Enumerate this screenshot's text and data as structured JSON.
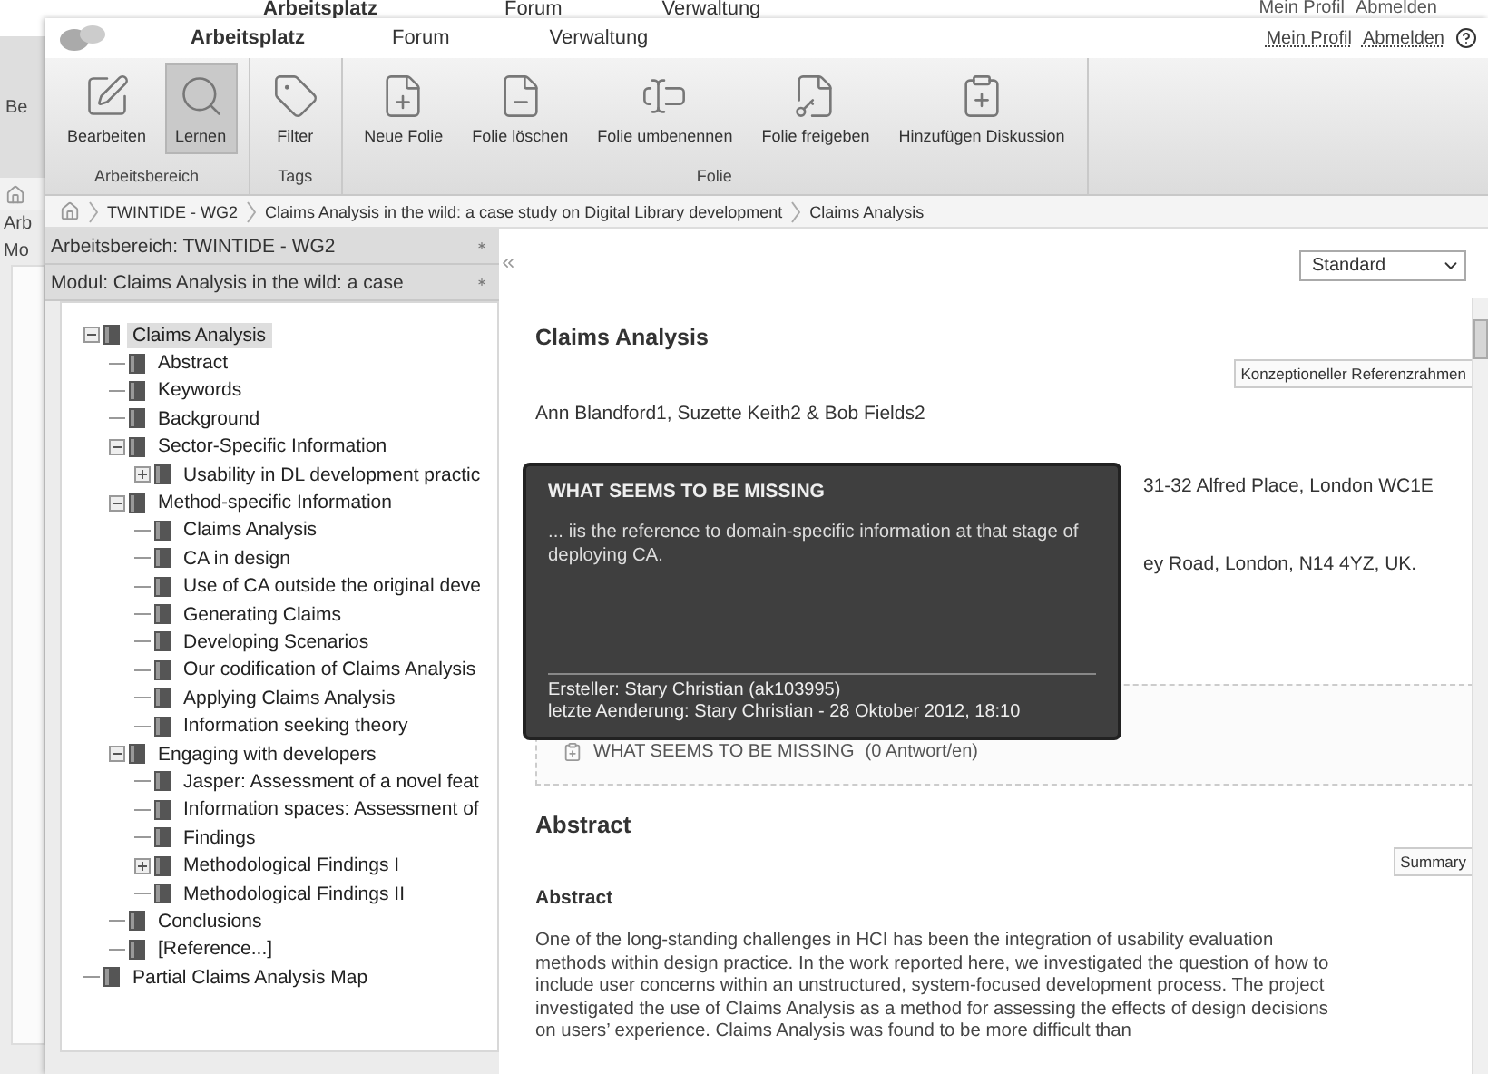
{
  "back_window": {
    "tabs": [
      {
        "label": "Arbeitsplatz",
        "selected": true
      },
      {
        "label": "Forum",
        "selected": false
      },
      {
        "label": "Verwaltung",
        "selected": false
      }
    ],
    "links": [
      "Mein Profil",
      "Abmelden"
    ],
    "side_texts": [
      "Be",
      "Arb",
      "Mo"
    ]
  },
  "header": {
    "tabs": [
      {
        "label": "Arbeitsplatz",
        "selected": true
      },
      {
        "label": "Forum",
        "selected": false
      },
      {
        "label": "Verwaltung",
        "selected": false
      }
    ],
    "links": [
      "Mein Profil",
      "Abmelden"
    ]
  },
  "ribbon": {
    "groups": [
      {
        "label": "Arbeitsbereich",
        "buttons": [
          {
            "label": "Bearbeiten",
            "kind": "edit",
            "selected": false
          },
          {
            "label": "Lernen",
            "kind": "learn",
            "selected": true
          }
        ]
      },
      {
        "label": "Tags",
        "buttons": [
          {
            "label": "Filter",
            "kind": "tag",
            "selected": false
          }
        ]
      },
      {
        "label": "Folie",
        "buttons": [
          {
            "label": "Neue Folie",
            "kind": "new",
            "selected": false
          },
          {
            "label": "Folie löschen",
            "kind": "delete",
            "selected": false
          },
          {
            "label": "Folie umbenennen",
            "kind": "rename",
            "selected": false
          },
          {
            "label": "Folie freigeben",
            "kind": "share",
            "selected": false
          },
          {
            "label": "Hinzufügen Diskussion",
            "kind": "discussion",
            "selected": false
          }
        ]
      }
    ]
  },
  "breadcrumb": [
    "TWINTIDE - WG2",
    "Claims Analysis in the wild: a case study on Digital Library development",
    "Claims Analysis"
  ],
  "sidebar": {
    "workspace": "Arbeitsbereich: TWINTIDE - WG2",
    "module": "Modul: Claims Analysis in the wild: a case",
    "tree": [
      {
        "label": "Claims Analysis",
        "selected": true,
        "expanded": true,
        "children": [
          {
            "label": "Abstract",
            "selected": false
          },
          {
            "label": "Keywords",
            "selected": false
          },
          {
            "label": "Background",
            "selected": false
          },
          {
            "label": "Sector-Specific Information",
            "selected": false,
            "expanded": true,
            "children": [
              {
                "label": "Usability in DL development practic",
                "selected": false,
                "expanded": false
              }
            ]
          },
          {
            "label": "Method-specific Information",
            "selected": false,
            "expanded": true,
            "children": [
              {
                "label": "Claims Analysis",
                "selected": false
              },
              {
                "label": "CA in design",
                "selected": false
              },
              {
                "label": "Use of CA outside the original deve",
                "selected": false
              },
              {
                "label": "Generating Claims",
                "selected": false
              },
              {
                "label": "Developing Scenarios",
                "selected": false
              },
              {
                "label": "Our codification of Claims Analysis",
                "selected": false
              },
              {
                "label": "Applying Claims Analysis",
                "selected": false
              },
              {
                "label": "Information seeking theory",
                "selected": false
              }
            ]
          },
          {
            "label": "Engaging with developers",
            "selected": false,
            "expanded": true,
            "children": [
              {
                "label": "Jasper: Assessment of a novel feat",
                "selected": false
              },
              {
                "label": "Information spaces: Assessment of",
                "selected": false
              },
              {
                "label": "Findings",
                "selected": false
              },
              {
                "label": "Methodological Findings I",
                "selected": false,
                "expanded": false
              },
              {
                "label": "Methodological Findings II",
                "selected": false
              }
            ]
          },
          {
            "label": "Conclusions",
            "selected": false
          },
          {
            "label": "[Reference...]",
            "selected": false
          }
        ]
      },
      {
        "label": "Partial Claims Analysis Map",
        "selected": false
      }
    ]
  },
  "content": {
    "view_select": "Standard",
    "title": "Claims Analysis",
    "title_tag": "Konzeptioneller Referenzrahmen",
    "authors": "Ann Blandford1, Suzette Keith2 & Bob Fields2",
    "address_lines": [
      "31-32 Alfred Place, London WC1E",
      "ey Road, London, N14 4YZ, UK."
    ],
    "discussion": {
      "title": "WHAT SEEMS TO BE MISSING",
      "replies": "(0 Antwort/en)"
    },
    "abstract": {
      "heading": "Abstract",
      "tag": "Summary",
      "subheading": "Abstract",
      "text": "One of the long-standing challenges in HCI has been the integration of usability evaluation methods within design practice. In the work reported here, we investigated the question of how to include user concerns within an unstructured, system-focused development process. The project investigated the use of Claims Analysis as a method for assessing the effects of design decisions on users’ experience. Claims Analysis was found to be more difficult than"
    }
  },
  "tooltip": {
    "title": "WHAT SEEMS TO BE MISSING",
    "body": "... iis the reference to domain-specific information at that stage of deploying CA.",
    "creator": "Ersteller: Stary Christian (ak103995)",
    "modified": "letzte Aenderung: Stary Christian - 28 Oktober 2012, 18:10"
  }
}
